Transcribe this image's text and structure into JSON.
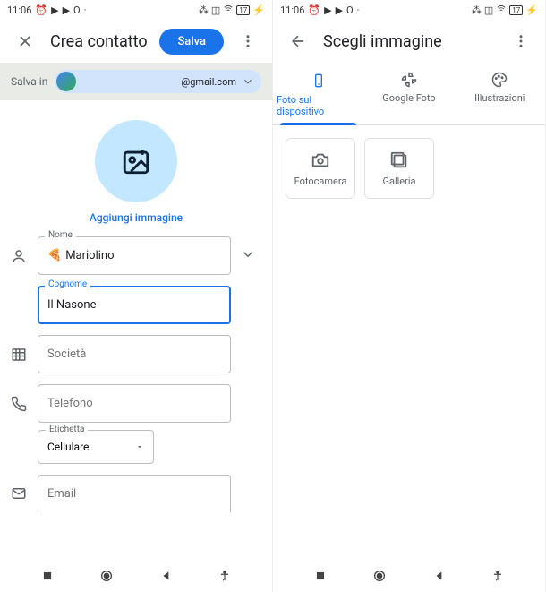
{
  "status": {
    "time": "11:06",
    "battery": "17"
  },
  "left": {
    "title": "Crea contatto",
    "save": "Salva",
    "save_in": "Salva in",
    "email": "@gmail.com",
    "add_image": "Aggiungi immagine",
    "name_label": "Nome",
    "name_value": "Mariolino",
    "surname_label": "Cognome",
    "surname_value": "Il Nasone",
    "company_ph": "Società",
    "phone_ph": "Telefono",
    "label_label": "Etichetta",
    "label_value": "Cellulare",
    "email_ph": "Email"
  },
  "right": {
    "title": "Scegli immagine",
    "tab_device": "Foto sul dispositivo",
    "tab_google": "Google Foto",
    "tab_illust": "Illustrazioni",
    "camera": "Fotocamera",
    "gallery": "Galleria"
  }
}
